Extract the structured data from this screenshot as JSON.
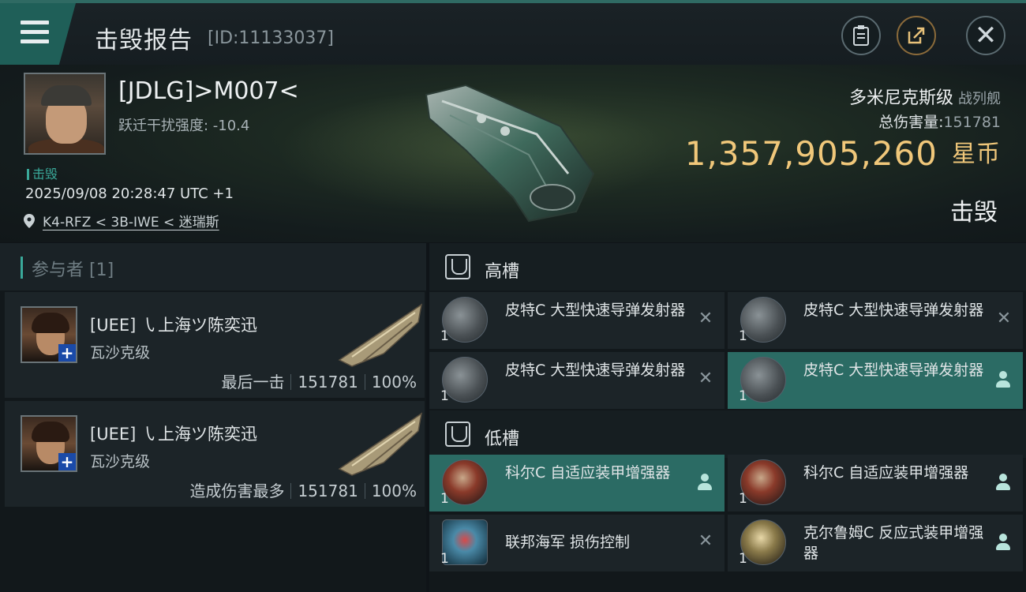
{
  "header": {
    "title": "击毁报告",
    "kill_id": "[ID:11133037]",
    "icons": [
      "menu-icon",
      "clipboard-icon",
      "share-icon",
      "close-icon"
    ]
  },
  "victim": {
    "name": "[JDLG]>M007<",
    "security_status": "跃迁干扰强度:  -10.4",
    "kill_tag": "击毁",
    "datetime": "2025/09/08 20:28:47 UTC +1",
    "location": "K4-RFZ < 3B-IWE < 迷瑞斯",
    "ship_class": "多米尼克斯级",
    "ship_type": "战列舰",
    "total_damage_label": "总伤害量:",
    "total_damage_value": "151781",
    "isk_value": "1,357,905,260",
    "isk_unit": "星币",
    "result": "击毁"
  },
  "participants": {
    "header": "参与者 [1]",
    "rows": [
      {
        "name": "[UEE] ㇂上海ツ陈奕迅",
        "ship": "瓦沙克级",
        "role": "最后一击",
        "damage": "151781",
        "percent": "100%"
      },
      {
        "name": "[UEE] ㇂上海ツ陈奕迅",
        "ship": "瓦沙克级",
        "role": "造成伤害最多",
        "damage": "151781",
        "percent": "100%"
      }
    ]
  },
  "fitting": {
    "high_label": "高槽",
    "low_label": "低槽",
    "high": [
      {
        "name": "皮特C 大型快速导弹发射器",
        "qty": "1",
        "state": "destroyed"
      },
      {
        "name": "皮特C 大型快速导弹发射器",
        "qty": "1",
        "state": "destroyed"
      },
      {
        "name": "皮特C 大型快速导弹发射器",
        "qty": "1",
        "state": "destroyed"
      },
      {
        "name": "皮特C 大型快速导弹发射器",
        "qty": "1",
        "state": "dropped"
      }
    ],
    "low": [
      {
        "name": "科尔C 自适应装甲增强器",
        "qty": "1",
        "state": "dropped"
      },
      {
        "name": "科尔C 自适应装甲增强器",
        "qty": "1",
        "state": "dropped"
      },
      {
        "name": "联邦海军 损伤控制",
        "qty": "1",
        "state": "destroyed"
      },
      {
        "name": "克尔鲁姆C 反应式装甲增强器",
        "qty": "1",
        "state": "dropped"
      }
    ]
  },
  "colors": {
    "accent": "#2b6b64",
    "isk": "#f0c77a",
    "teal": "#3aa99a"
  }
}
